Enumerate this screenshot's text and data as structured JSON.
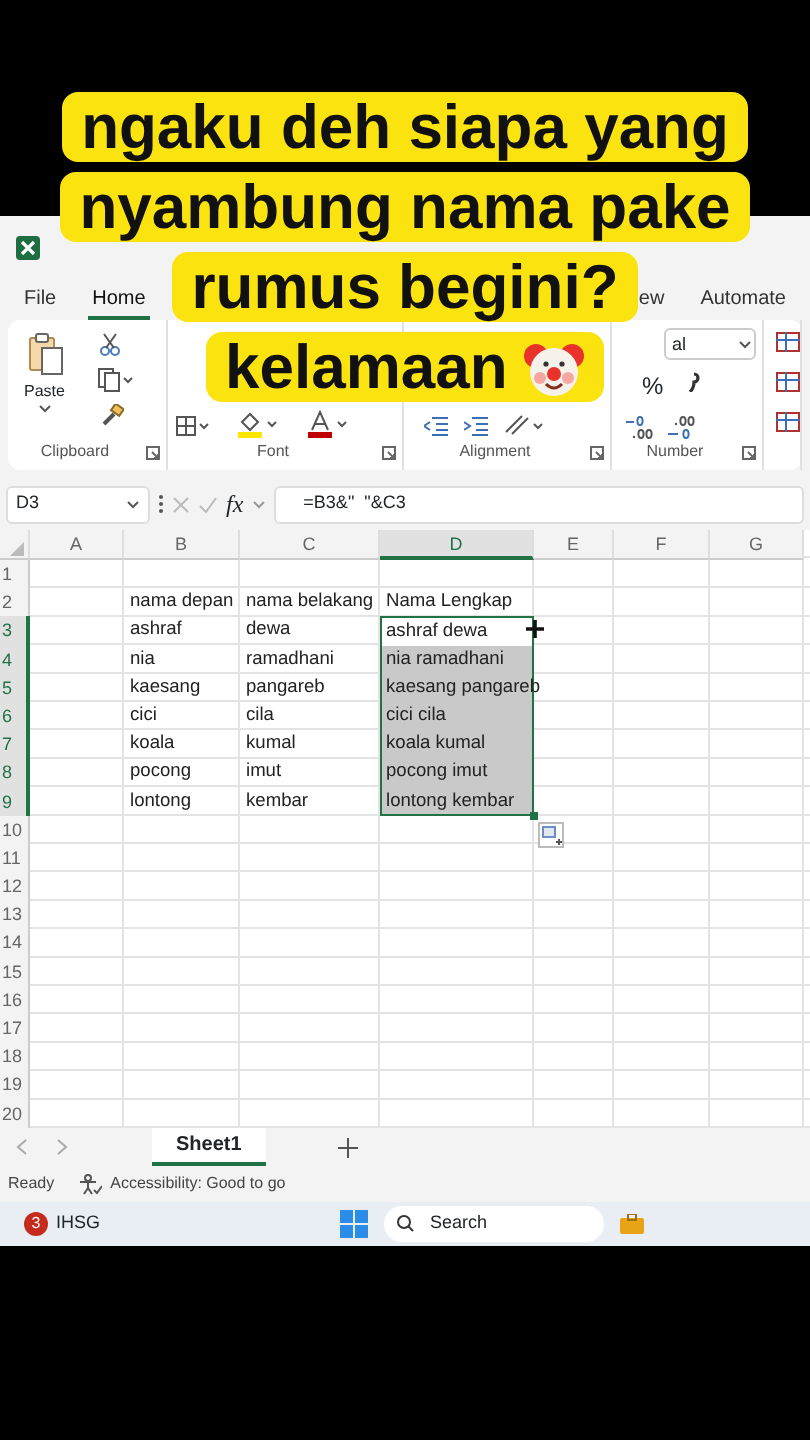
{
  "caption": {
    "lines": [
      "ngaku deh siapa yang",
      "nyambung nama pake",
      "rumus begini?",
      "kelamaan"
    ]
  },
  "ribbon_tabs": [
    {
      "label": "File",
      "selected": false
    },
    {
      "label": "Home",
      "selected": true
    },
    {
      "label": "ew",
      "selected": false
    },
    {
      "label": "Automate",
      "selected": false
    }
  ],
  "ribbon": {
    "paste_label": "Paste",
    "font_name": "al",
    "percent_symbol": "%",
    "groups": [
      {
        "label": "Clipboard"
      },
      {
        "label": "Font"
      },
      {
        "label": "Alignment"
      },
      {
        "label": "Number"
      }
    ]
  },
  "formula_bar": {
    "name_box": "D3",
    "fx": "fx",
    "formula": "=B3&\"  \"&C3"
  },
  "columns": [
    {
      "label": "A",
      "selected": false
    },
    {
      "label": "B",
      "selected": false
    },
    {
      "label": "C",
      "selected": false
    },
    {
      "label": "D",
      "selected": true
    },
    {
      "label": "E",
      "selected": false
    },
    {
      "label": "F",
      "selected": false
    },
    {
      "label": "G",
      "selected": false
    }
  ],
  "rows": [
    {
      "label": "1",
      "selected": false
    },
    {
      "label": "2",
      "selected": false,
      "cells": [
        "nama depan",
        "nama belakang",
        "Nama Lengkap"
      ]
    },
    {
      "label": "3",
      "selected": true,
      "cells": [
        "ashraf",
        "dewa",
        "ashraf dewa"
      ]
    },
    {
      "label": "4",
      "selected": true,
      "cells": [
        "nia",
        "ramadhani",
        "nia ramadhani"
      ]
    },
    {
      "label": "5",
      "selected": true,
      "cells": [
        "kaesang",
        "pangareb",
        "kaesang pangareb"
      ]
    },
    {
      "label": "6",
      "selected": true,
      "cells": [
        "cici",
        "cila",
        "cici cila"
      ]
    },
    {
      "label": "7",
      "selected": true,
      "cells": [
        "koala",
        "kumal",
        "koala kumal"
      ]
    },
    {
      "label": "8",
      "selected": true,
      "cells": [
        "pocong",
        "imut",
        "pocong imut"
      ]
    },
    {
      "label": "9",
      "selected": true,
      "cells": [
        "lontong",
        "kembar",
        "lontong kembar"
      ]
    },
    {
      "label": "10",
      "selected": false
    },
    {
      "label": "11",
      "selected": false
    },
    {
      "label": "12",
      "selected": false
    },
    {
      "label": "13",
      "selected": false
    },
    {
      "label": "14",
      "selected": false
    },
    {
      "label": "15",
      "selected": false
    },
    {
      "label": "16",
      "selected": false
    },
    {
      "label": "17",
      "selected": false
    },
    {
      "label": "18",
      "selected": false
    },
    {
      "label": "19",
      "selected": false
    },
    {
      "label": "20",
      "selected": false
    }
  ],
  "sheet_tabs": [
    {
      "label": "Sheet1",
      "selected": true
    }
  ],
  "status_bar": {
    "mode": "Ready",
    "accessibility": "Accessibility: Good to go"
  },
  "taskbar": {
    "widget_badge": "3",
    "widget_label": "IHSG",
    "search_placeholder": "Search"
  }
}
